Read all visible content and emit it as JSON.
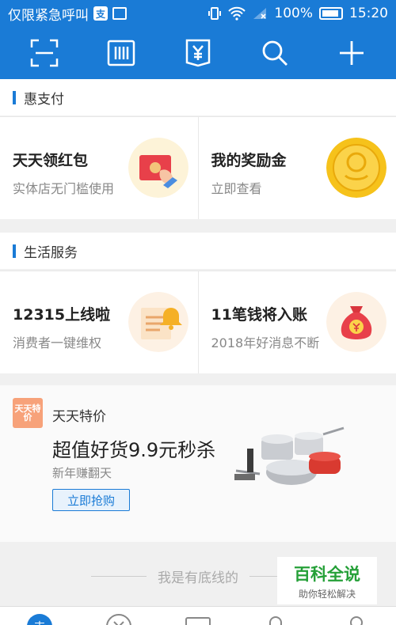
{
  "status_bar": {
    "carrier": "仅限紧急呼叫",
    "battery": "100%",
    "time": "15:20"
  },
  "toolbar": {
    "icons": [
      "scan-icon",
      "barcode-pay-icon",
      "collect-money-icon",
      "search-icon",
      "add-icon"
    ]
  },
  "hui_pay": {
    "section_title": "惠支付",
    "cards": [
      {
        "title": "天天领红包",
        "subtitle": "实体店无门槛使用",
        "icon": "red-envelope-icon"
      },
      {
        "title": "我的奖励金",
        "subtitle": "立即查看",
        "icon": "gold-coin-icon"
      }
    ]
  },
  "life_service": {
    "section_title": "生活服务",
    "cards": [
      {
        "title": "12315上线啦",
        "subtitle": "消费者一键维权",
        "icon": "bell-document-icon"
      },
      {
        "title": "11笔钱将入账",
        "subtitle": "2018年好消息不断",
        "icon": "money-bag-icon"
      }
    ]
  },
  "promo": {
    "logo_text": "天天特价",
    "name": "天天特价",
    "title": "超值好货9.9元秒杀",
    "subtitle": "新年赚翻天",
    "button": "立即抢购"
  },
  "footer_note": "我是有底线的",
  "watermark": {
    "main": "百科全说",
    "sub": "助你轻松解决"
  },
  "colors": {
    "brand_blue": "#1a7bd6",
    "watermark_green": "#25a038"
  }
}
